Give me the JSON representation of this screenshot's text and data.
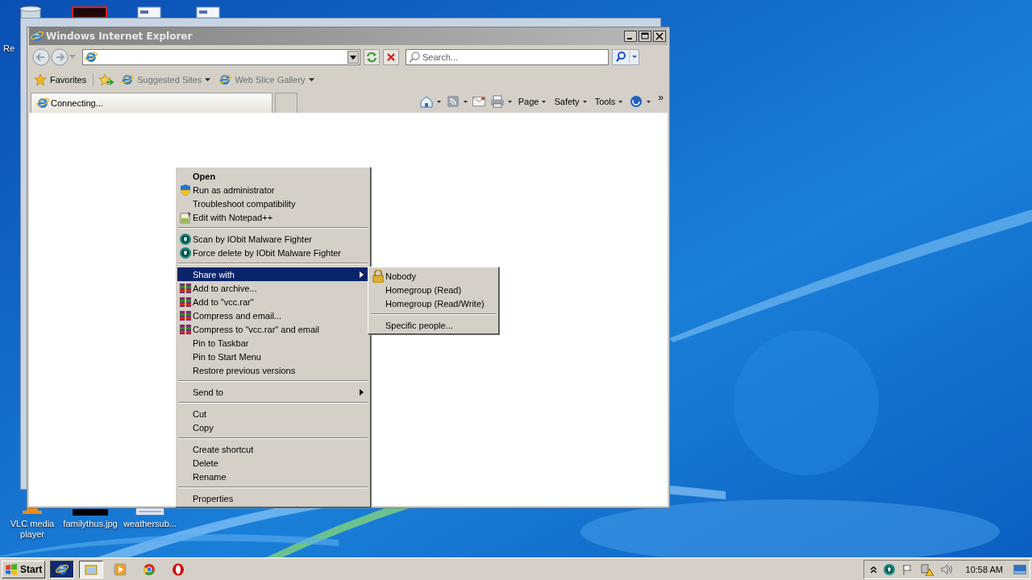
{
  "desktop": {
    "icons": [
      {
        "label": "Re",
        "kind": "bin"
      },
      {
        "label": "VLC media player",
        "kind": "vlc"
      },
      {
        "label": "familythus.jpg"
      },
      {
        "label": "weathersub...",
        "kind": "doc"
      }
    ]
  },
  "browser": {
    "title": "Windows Internet Explorer",
    "search": {
      "placeholder": "Search..."
    },
    "favorites": {
      "label": "Favorites",
      "links": [
        {
          "label": "Suggested Sites"
        },
        {
          "label": "Web Slice Gallery"
        }
      ]
    },
    "tabs": [
      {
        "label": "Connecting...",
        "selected": true
      }
    ],
    "commands": [
      {
        "label": "Page"
      },
      {
        "label": "Safety"
      },
      {
        "label": "Tools"
      }
    ],
    "overflow": "»"
  },
  "context_menu": {
    "groups": [
      [
        {
          "label": "Open",
          "kind": "plain",
          "bold": true,
          "submenu": false,
          "selected": false
        },
        {
          "label": "Run as administrator",
          "kind": "admin",
          "bold": false,
          "submenu": false,
          "selected": false
        },
        {
          "label": "Troubleshoot compatibility",
          "kind": "plain",
          "bold": false,
          "submenu": false,
          "selected": false
        },
        {
          "label": "Edit with Notepad++",
          "kind": "editor",
          "bold": false,
          "submenu": false,
          "selected": false
        }
      ],
      [
        {
          "label": "Scan by IObit Malware Fighter",
          "kind": "scanner",
          "bold": false,
          "submenu": false,
          "selected": false
        },
        {
          "label": "Force delete by IObit Malware Fighter",
          "kind": "scanner",
          "bold": false,
          "submenu": false,
          "selected": false
        }
      ],
      [
        {
          "label": "Share with",
          "kind": "plain",
          "bold": false,
          "submenu": true,
          "selected": true
        },
        {
          "label": "Add to archive...",
          "kind": "archive",
          "bold": false,
          "submenu": false,
          "selected": false
        },
        {
          "label": "Add to \"vcc.rar\"",
          "kind": "archive",
          "bold": false,
          "submenu": false,
          "selected": false
        },
        {
          "label": "Compress and email...",
          "kind": "archive",
          "bold": false,
          "submenu": false,
          "selected": false
        },
        {
          "label": "Compress to \"vcc.rar\" and email",
          "kind": "archive",
          "bold": false,
          "submenu": false,
          "selected": false
        },
        {
          "label": "Pin to Taskbar",
          "kind": "plain",
          "bold": false,
          "submenu": false,
          "selected": false
        },
        {
          "label": "Pin to Start Menu",
          "kind": "plain",
          "bold": false,
          "submenu": false,
          "selected": false
        },
        {
          "label": "Restore previous versions",
          "kind": "plain",
          "bold": false,
          "submenu": false,
          "selected": false
        }
      ],
      [
        {
          "label": "Send to",
          "kind": "plain",
          "bold": false,
          "submenu": true,
          "selected": false
        }
      ],
      [
        {
          "label": "Cut",
          "kind": "plain",
          "bold": false,
          "submenu": false,
          "selected": false
        },
        {
          "label": "Copy",
          "kind": "plain",
          "bold": false,
          "submenu": false,
          "selected": false
        }
      ],
      [
        {
          "label": "Create shortcut",
          "kind": "plain",
          "bold": false,
          "submenu": false,
          "selected": false
        },
        {
          "label": "Delete",
          "kind": "plain",
          "bold": false,
          "submenu": false,
          "selected": false
        },
        {
          "label": "Rename",
          "kind": "plain",
          "bold": false,
          "submenu": false,
          "selected": false
        }
      ],
      [
        {
          "label": "Properties",
          "kind": "plain",
          "bold": false,
          "submenu": false,
          "selected": false
        }
      ]
    ]
  },
  "submenu": {
    "groups": [
      [
        {
          "label": "Nobody",
          "kind": "lock"
        },
        {
          "label": "Homegroup (Read)",
          "kind": "plain"
        },
        {
          "label": "Homegroup (Read/Write)",
          "kind": "plain"
        }
      ],
      [
        {
          "label": "Specific people...",
          "kind": "plain"
        }
      ]
    ]
  },
  "taskbar": {
    "start": "Start",
    "apps": [
      {
        "kind": "ie",
        "selected": true
      },
      {
        "kind": "folder",
        "selected": true
      },
      {
        "kind": "media",
        "selected": false
      },
      {
        "kind": "chrome",
        "selected": false
      },
      {
        "kind": "opera",
        "selected": false
      }
    ],
    "clock": "10:58 AM"
  }
}
